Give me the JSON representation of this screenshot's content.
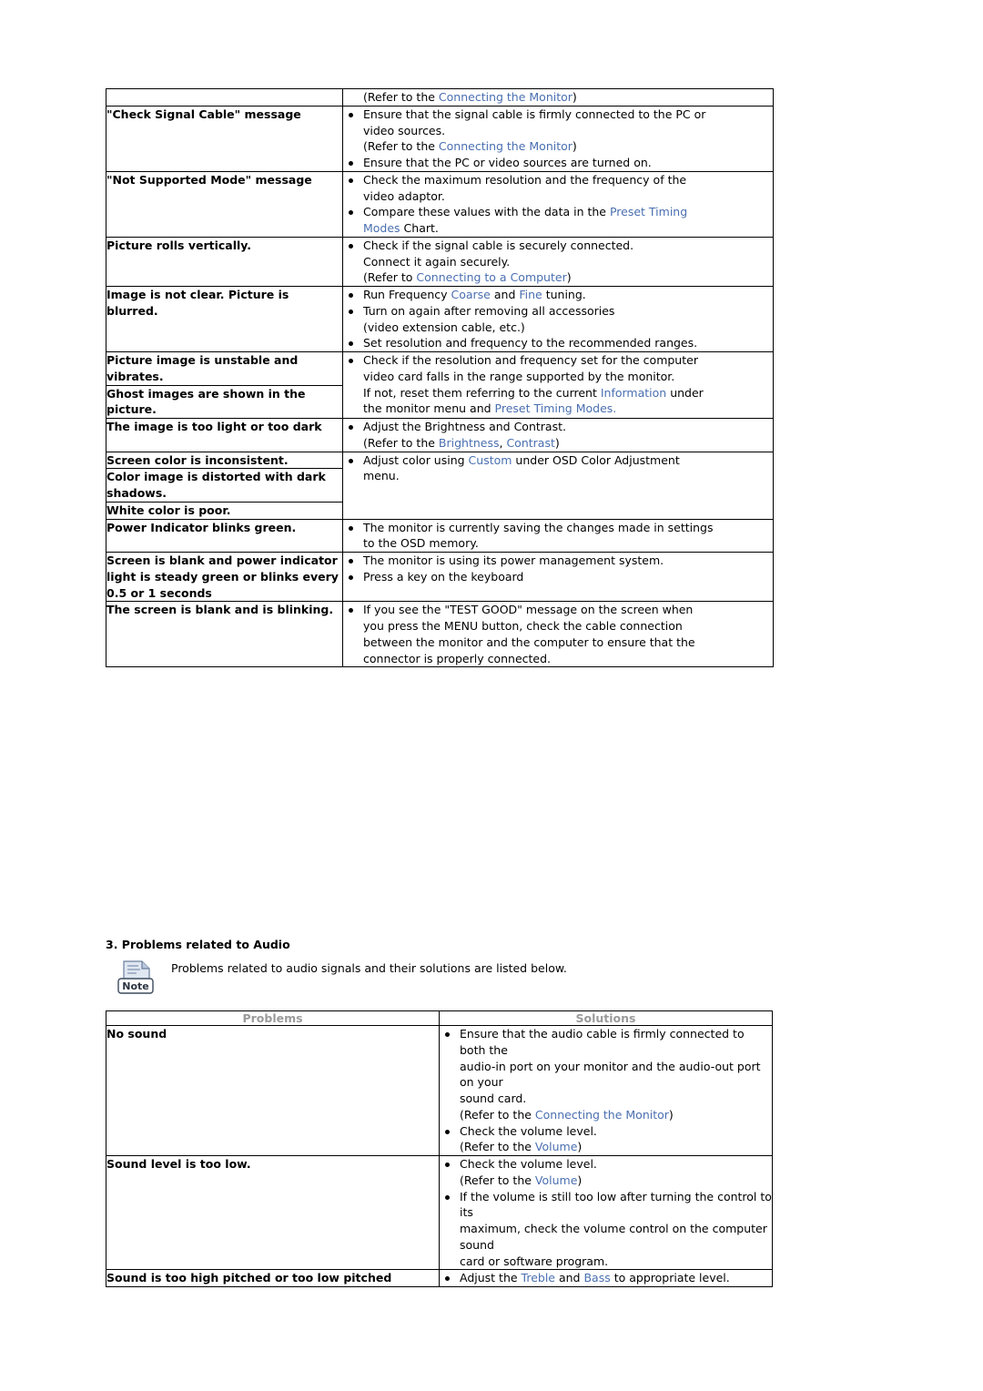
{
  "document": {
    "table1": {
      "rows": [
        {
          "problem": "",
          "solution_lines": [
            {
              "type": "plain",
              "segments": [
                {
                  "t": "(Refer to the "
                },
                {
                  "t": "Connecting the Monitor",
                  "link": true
                },
                {
                  "t": ")"
                }
              ]
            }
          ]
        },
        {
          "problem": "\"Check Signal Cable\" message",
          "solution_lines": [
            {
              "type": "bullet",
              "segments": [
                {
                  "t": "Ensure that the signal cable is firmly connected to the PC or"
                }
              ]
            },
            {
              "type": "cont",
              "segments": [
                {
                  "t": "video sources."
                }
              ]
            },
            {
              "type": "cont",
              "segments": [
                {
                  "t": "(Refer to the "
                },
                {
                  "t": "Connecting the Monitor",
                  "link": true
                },
                {
                  "t": ")"
                }
              ]
            },
            {
              "type": "bullet",
              "segments": [
                {
                  "t": "Ensure that the PC or video sources are turned on."
                }
              ]
            }
          ]
        },
        {
          "problem": "\"Not Supported Mode\" message",
          "solution_lines": [
            {
              "type": "bullet",
              "segments": [
                {
                  "t": "Check the maximum resolution and the frequency of the"
                }
              ]
            },
            {
              "type": "cont",
              "segments": [
                {
                  "t": "video adaptor."
                }
              ]
            },
            {
              "type": "bullet",
              "segments": [
                {
                  "t": "Compare these values with the data in the "
                },
                {
                  "t": "Preset Timing",
                  "link": true
                }
              ]
            },
            {
              "type": "cont",
              "segments": [
                {
                  "t": "Modes",
                  "link": true
                },
                {
                  "t": " Chart."
                }
              ]
            }
          ]
        },
        {
          "problem": "Picture rolls vertically.",
          "solution_lines": [
            {
              "type": "bullet",
              "segments": [
                {
                  "t": "Check if the signal cable is securely connected."
                }
              ]
            },
            {
              "type": "cont",
              "segments": [
                {
                  "t": "Connect it again securely."
                }
              ]
            },
            {
              "type": "cont",
              "segments": [
                {
                  "t": "(Refer to "
                },
                {
                  "t": "Connecting to a Computer",
                  "link": true
                },
                {
                  "t": ")"
                }
              ]
            }
          ]
        },
        {
          "problem": "Image is not clear. Picture is blurred.",
          "solution_lines": [
            {
              "type": "bullet",
              "segments": [
                {
                  "t": "Run Frequency "
                },
                {
                  "t": "Coarse",
                  "link": true
                },
                {
                  "t": " and "
                },
                {
                  "t": "Fine",
                  "link": true
                },
                {
                  "t": " tuning."
                }
              ]
            },
            {
              "type": "bullet",
              "segments": [
                {
                  "t": "Turn on again after removing all accessories"
                }
              ]
            },
            {
              "type": "cont",
              "segments": [
                {
                  "t": "(video extension cable, etc.)"
                }
              ]
            },
            {
              "type": "bullet",
              "segments": [
                {
                  "t": "Set resolution and frequency to the recommended ranges."
                }
              ]
            }
          ]
        },
        {
          "problem": "Picture image is unstable and vibrates.",
          "problem2": "Ghost images are shown in the picture.",
          "solution_lines": [
            {
              "type": "bullet",
              "segments": [
                {
                  "t": "Check if the resolution and frequency set for the computer"
                }
              ]
            },
            {
              "type": "cont",
              "segments": [
                {
                  "t": "video card falls in the range supported by the monitor."
                }
              ]
            },
            {
              "type": "cont",
              "segments": [
                {
                  "t": "If not, reset them referring to the current "
                },
                {
                  "t": "Information",
                  "link": true
                },
                {
                  "t": " under"
                }
              ]
            },
            {
              "type": "cont",
              "segments": [
                {
                  "t": "the monitor menu and "
                },
                {
                  "t": "Preset Timing Modes.",
                  "link": true
                }
              ]
            }
          ]
        },
        {
          "problem": "The image is too light or too dark",
          "solution_lines": [
            {
              "type": "bullet",
              "segments": [
                {
                  "t": "Adjust the Brightness and Contrast."
                }
              ]
            },
            {
              "type": "cont",
              "segments": [
                {
                  "t": "(Refer to the "
                },
                {
                  "t": "Brightness",
                  "link": true
                },
                {
                  "t": ", "
                },
                {
                  "t": "Contrast",
                  "link": true
                },
                {
                  "t": ")"
                }
              ]
            }
          ]
        },
        {
          "problem": "Screen color is inconsistent.",
          "problem2": "Color image is distorted with dark shadows.",
          "problem3": "White color is poor.",
          "solution_lines": [
            {
              "type": "bullet",
              "segments": [
                {
                  "t": "Adjust color using "
                },
                {
                  "t": "Custom",
                  "link": true
                },
                {
                  "t": " under OSD Color Adjustment"
                }
              ]
            },
            {
              "type": "cont",
              "segments": [
                {
                  "t": "menu."
                }
              ]
            }
          ]
        },
        {
          "problem": "Power Indicator blinks green.",
          "solution_lines": [
            {
              "type": "bullet",
              "segments": [
                {
                  "t": "The monitor is currently saving the changes made in settings"
                }
              ]
            },
            {
              "type": "cont",
              "segments": [
                {
                  "t": "to the OSD memory."
                }
              ]
            }
          ]
        },
        {
          "problem": "Screen is blank and power indicator light is steady green or blinks every 0.5 or 1 seconds",
          "solution_lines": [
            {
              "type": "bullet",
              "segments": [
                {
                  "t": "The monitor is using its power management system."
                }
              ]
            },
            {
              "type": "bullet",
              "segments": [
                {
                  "t": "Press a key on the keyboard"
                }
              ]
            }
          ]
        },
        {
          "problem": "The screen is blank and is blinking.",
          "solution_lines": [
            {
              "type": "bullet",
              "segments": [
                {
                  "t": "If you see the \"TEST GOOD\" message on the screen when"
                }
              ]
            },
            {
              "type": "cont",
              "segments": [
                {
                  "t": "you press the MENU button, check the cable connection"
                }
              ]
            },
            {
              "type": "cont",
              "segments": [
                {
                  "t": "between the monitor and the computer to ensure that the"
                }
              ]
            },
            {
              "type": "cont",
              "segments": [
                {
                  "t": "connector is properly connected."
                }
              ]
            }
          ]
        }
      ]
    },
    "section3": {
      "title": "3. Problems related to Audio",
      "note_icon_label": "Note",
      "note_text": "Problems related to audio signals and their solutions are listed below."
    },
    "table2": {
      "header": {
        "problems": "Problems",
        "solutions": "Solutions"
      },
      "rows": [
        {
          "problem": "No sound",
          "solution_lines": [
            {
              "type": "bullet",
              "segments": [
                {
                  "t": "Ensure that the audio cable is firmly connected to both the"
                }
              ]
            },
            {
              "type": "cont",
              "segments": [
                {
                  "t": "audio-in port on your monitor and the audio-out port on your"
                }
              ]
            },
            {
              "type": "cont",
              "segments": [
                {
                  "t": "sound card."
                }
              ]
            },
            {
              "type": "cont",
              "segments": [
                {
                  "t": "(Refer to the "
                },
                {
                  "t": "Connecting the Monitor",
                  "link": true
                },
                {
                  "t": ")"
                }
              ]
            },
            {
              "type": "bullet",
              "segments": [
                {
                  "t": "Check the volume level."
                }
              ]
            },
            {
              "type": "cont",
              "segments": [
                {
                  "t": "(Refer to the "
                },
                {
                  "t": "Volume",
                  "link": true
                },
                {
                  "t": ")"
                }
              ]
            }
          ]
        },
        {
          "problem": "Sound level is too low.",
          "solution_lines": [
            {
              "type": "bullet",
              "segments": [
                {
                  "t": "Check the volume level."
                }
              ]
            },
            {
              "type": "cont",
              "segments": [
                {
                  "t": "(Refer to the "
                },
                {
                  "t": "Volume",
                  "link": true
                },
                {
                  "t": ")"
                }
              ]
            },
            {
              "type": "bullet",
              "segments": [
                {
                  "t": "If the volume is still too low after turning the control to its"
                }
              ]
            },
            {
              "type": "cont",
              "segments": [
                {
                  "t": "maximum, check the volume control on the computer sound"
                }
              ]
            },
            {
              "type": "cont",
              "segments": [
                {
                  "t": "card or software program."
                }
              ]
            }
          ]
        },
        {
          "problem": "Sound is too high pitched or too low pitched",
          "solution_lines": [
            {
              "type": "bullet",
              "segments": [
                {
                  "t": "Adjust the "
                },
                {
                  "t": "Treble",
                  "link": true
                },
                {
                  "t": " and "
                },
                {
                  "t": "Bass",
                  "link": true
                },
                {
                  "t": " to appropriate level."
                }
              ]
            }
          ]
        }
      ]
    }
  }
}
